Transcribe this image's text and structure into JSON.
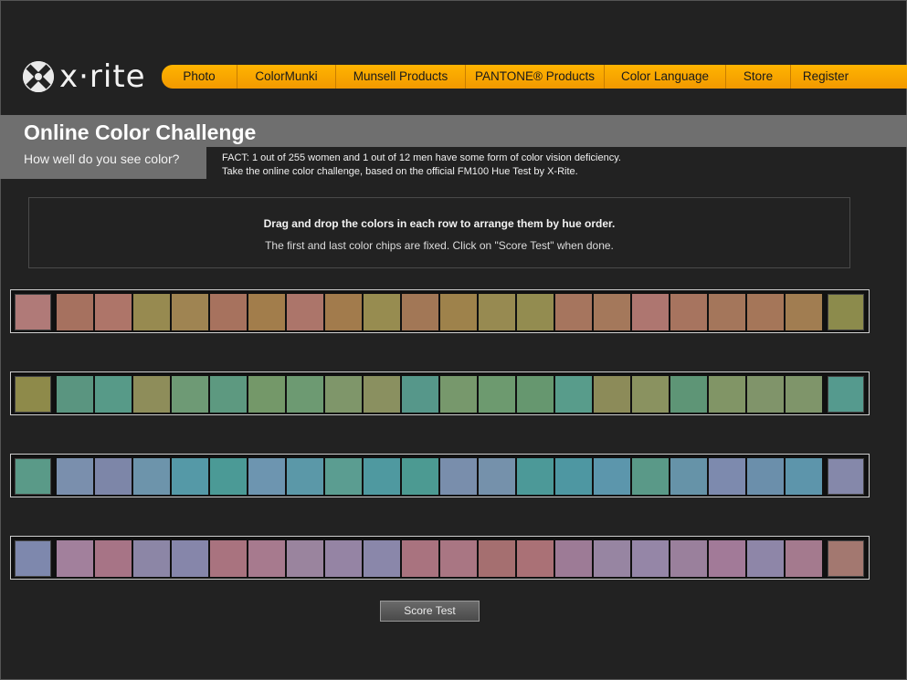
{
  "brand": {
    "name": "x·rite"
  },
  "nav": {
    "items": [
      {
        "label": "Photo"
      },
      {
        "label": "ColorMunki"
      },
      {
        "label": "Munsell Products"
      },
      {
        "label": "PANTONE® Products"
      },
      {
        "label": "Color Language"
      },
      {
        "label": "Store"
      },
      {
        "label": "Register"
      }
    ],
    "color_start": "#ffb400",
    "color_end": "#f29900"
  },
  "header": {
    "title": "Online Color Challenge",
    "subtitle": "How well do you see color?",
    "fact_line1": "FACT: 1 out of 255 women and 1 out of 12 men have some form of color vision deficiency.",
    "fact_line2": "Take the online color challenge, based on the official FM100 Hue Test by X-Rite."
  },
  "instructions": {
    "line1": "Drag and drop the colors in each row to arrange them by hue order.",
    "line2": "The first and last color chips are fixed. Click on \"Score Test\" when done."
  },
  "rows": [
    {
      "chips": [
        "#b07a78",
        "#a6715f",
        "#ae7569",
        "#978a50",
        "#9f8452",
        "#a7725e",
        "#a27d4b",
        "#ac756a",
        "#a27b4c",
        "#978c50",
        "#a27756",
        "#9e824b",
        "#978a51",
        "#938c50",
        "#a6755e",
        "#a4785b",
        "#ae7670",
        "#a7745f",
        "#a4765b",
        "#a57659",
        "#a17d51",
        "#8c8b4c"
      ]
    },
    {
      "chips": [
        "#8e8a4a",
        "#5a9580",
        "#579a88",
        "#8e8d5a",
        "#6e9a75",
        "#5d9980",
        "#749869",
        "#6d9a72",
        "#7f966a",
        "#8a9060",
        "#56978a",
        "#77986c",
        "#6d9a6f",
        "#66976f",
        "#589c8b",
        "#8c8b59",
        "#8a9260",
        "#5e9576",
        "#819566",
        "#80946a",
        "#7f956a",
        "#559a8e"
      ]
    },
    {
      "chips": [
        "#5a9a88",
        "#7a8fad",
        "#7d86a8",
        "#6d94ab",
        "#5599a7",
        "#4b9a96",
        "#6d95b0",
        "#5b98a8",
        "#5b9d91",
        "#4f99a0",
        "#4c9a92",
        "#798eac",
        "#7591ab",
        "#4c9998",
        "#4e97a2",
        "#5c96ac",
        "#5a9988",
        "#6693a8",
        "#7d8aae",
        "#6b8fab",
        "#5d95ab",
        "#8588aa"
      ]
    },
    {
      "chips": [
        "#7e88ad",
        "#a2809c",
        "#a77486",
        "#8c86a6",
        "#8686aa",
        "#a9737f",
        "#a77a8e",
        "#9a849e",
        "#9584a4",
        "#8a87aa",
        "#a9737f",
        "#a97683",
        "#a56f70",
        "#aa7176",
        "#9d7b96",
        "#9785a2",
        "#9586a7",
        "#9a809c",
        "#a27a98",
        "#8e86a8",
        "#a47a8e",
        "#a37870"
      ]
    }
  ],
  "buttons": {
    "score": "Score Test"
  }
}
